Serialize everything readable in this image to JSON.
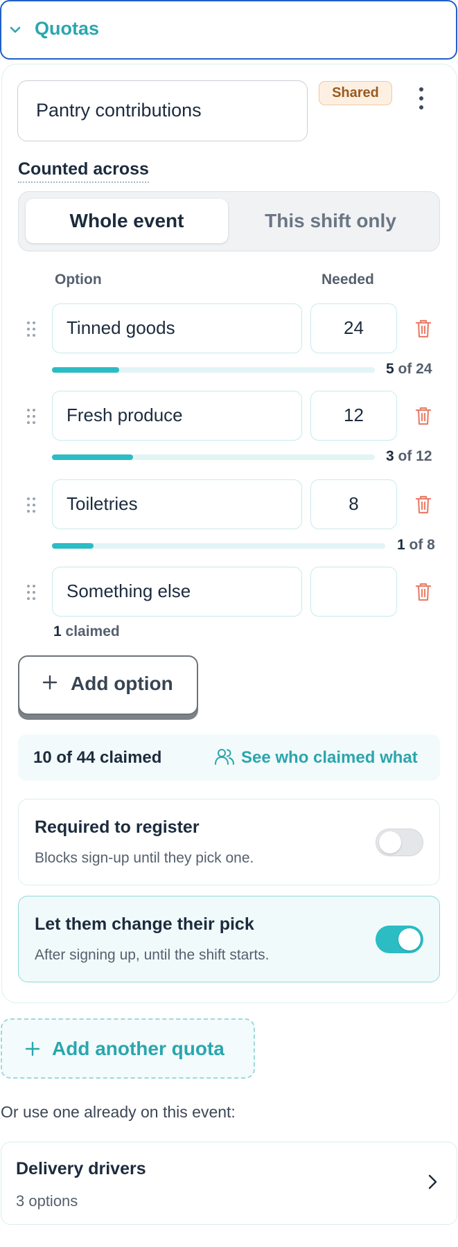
{
  "section": {
    "title": "Quotas",
    "icon": "chevron-down-icon"
  },
  "quota": {
    "name": "Pantry contributions",
    "badge": "Shared",
    "menu_icon": "kebab-menu-icon",
    "counted_across": {
      "label": "Counted across",
      "options": [
        "Whole event",
        "This shift only"
      ],
      "selected": "Whole event"
    },
    "columns": {
      "option": "Option",
      "needed": "Needed"
    },
    "options": [
      {
        "name": "Tinned goods",
        "needed": "24",
        "claimed": "5",
        "of_text": "of 24",
        "progress": 0.2083
      },
      {
        "name": "Fresh produce",
        "needed": "12",
        "claimed": "3",
        "of_text": "of 12",
        "progress": 0.25
      },
      {
        "name": "Toiletries",
        "needed": "8",
        "claimed": "1",
        "of_text": "of 8",
        "progress": 0.125
      },
      {
        "name": "Something else",
        "needed": "",
        "claimed": "1",
        "claimed_label": "claimed"
      }
    ],
    "add_option_label": "Add option",
    "summary": {
      "count": "10 of 44 claimed",
      "link": "See who claimed what",
      "link_icon": "people-icon"
    },
    "settings": [
      {
        "title": "Required to register",
        "description": "Blocks sign-up until they pick one.",
        "enabled": false
      },
      {
        "title": "Let them change their pick",
        "description": "After signing up, until the shift starts.",
        "enabled": true
      }
    ]
  },
  "add_quota_label": "Add another quota",
  "existing_intro": "Or use one already on this event:",
  "existing_quota": {
    "title": "Delivery drivers",
    "subtitle": "3 options",
    "icon": "chevron-right-icon"
  },
  "colors": {
    "accent": "#2bbcc4",
    "accent_text": "#2aa6ae",
    "focus_border": "#1f5fc8",
    "delete": "#e9806c",
    "badge_bg": "#fdf0e3"
  }
}
